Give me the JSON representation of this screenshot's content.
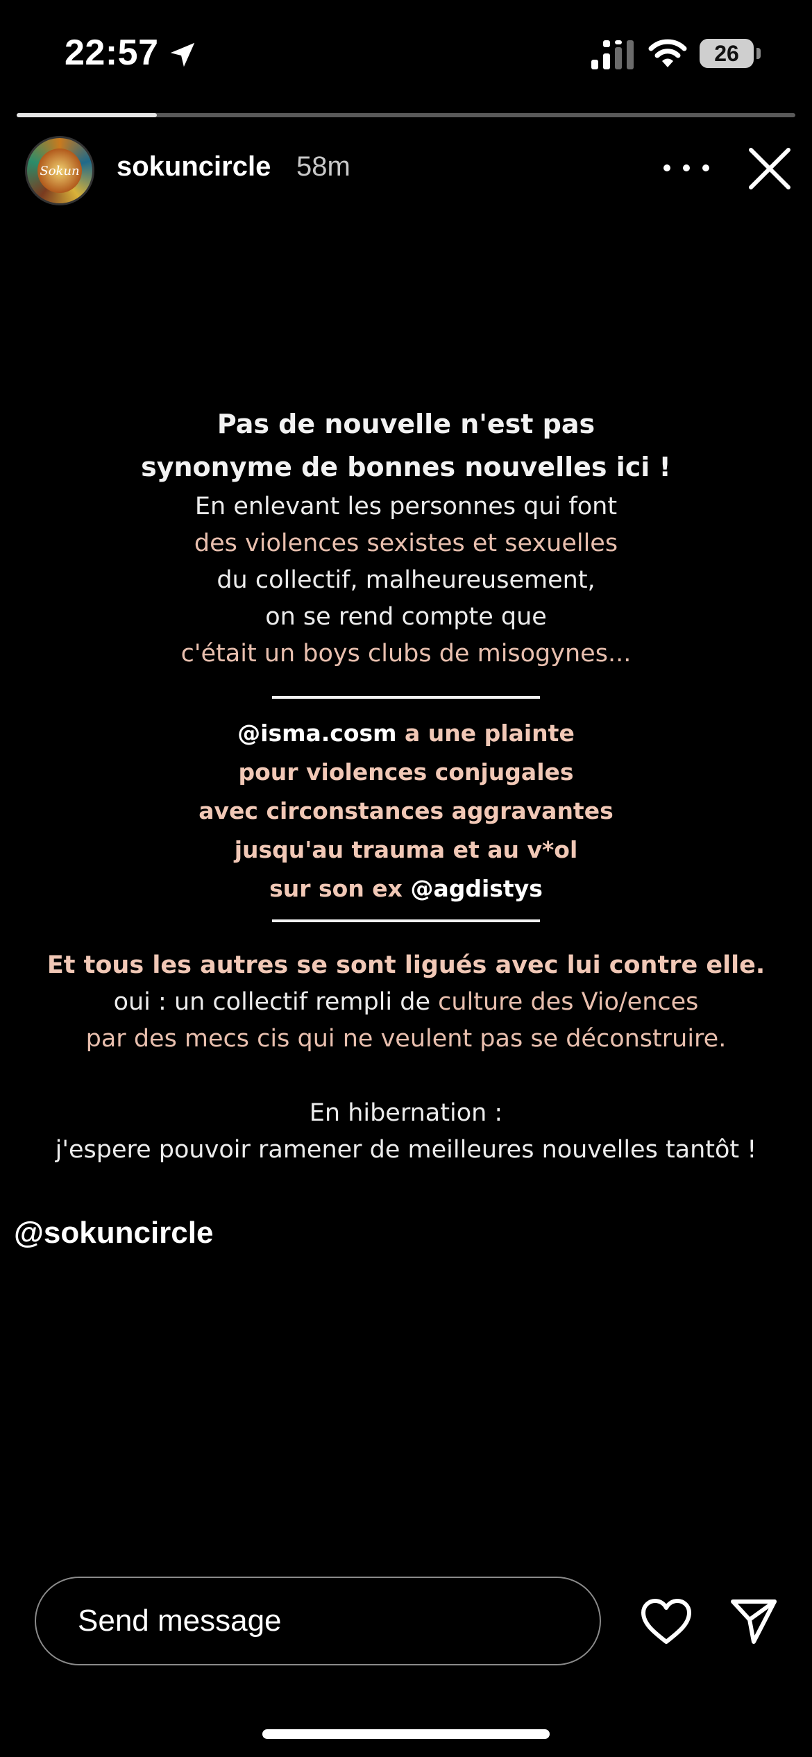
{
  "status_bar": {
    "time": "22:57",
    "battery": "26",
    "icons": [
      "location-arrow-icon",
      "signal-icon",
      "wifi-icon",
      "battery-icon"
    ]
  },
  "story_progress": 0.18,
  "header": {
    "avatar_text": "Sokun",
    "username": "sokuncircle",
    "age": "58m",
    "icons": [
      "more-options-icon",
      "close-icon"
    ]
  },
  "story": {
    "headline_1": "Pas de nouvelle n'est pas",
    "headline_2": "synonyme de bonnes nouvelles ici !",
    "line_1": "En enlevant les personnes qui font",
    "line_2": "des violences sexistes et sexuelles",
    "line_3": "du collectif, malheureusement,",
    "line_4": "on se rend compte que",
    "line_5": "c'était un boys clubs de misogynes...",
    "block_mention_1": "@isma.cosm",
    "block_1_rest": " a une plainte",
    "block_2": "pour violences conjugales",
    "block_3": "avec circonstances aggravantes",
    "block_4": "jusqu'au trauma et au v*ol",
    "block_5_start": "sur son ex ",
    "block_mention_2": "@agdistys",
    "statement": "Et tous les autres se sont ligués avec lui contre elle.",
    "line_6_start": "oui : un collectif rempli de ",
    "line_6_highlight": "culture des Vio/ences",
    "line_7": "par des mecs cis qui ne veulent pas se déconstruire.",
    "line_8": "En hibernation :",
    "line_9": "j'espere pouvoir ramener de meilleures nouvelles tantôt !"
  },
  "mention_sticker": "@sokuncircle",
  "footer": {
    "message_placeholder": "Send message",
    "icons": [
      "heart-icon",
      "send-icon"
    ]
  },
  "colors": {
    "background": "#000000",
    "accent_peach": "#e8bfae",
    "text": "#ffffff"
  }
}
